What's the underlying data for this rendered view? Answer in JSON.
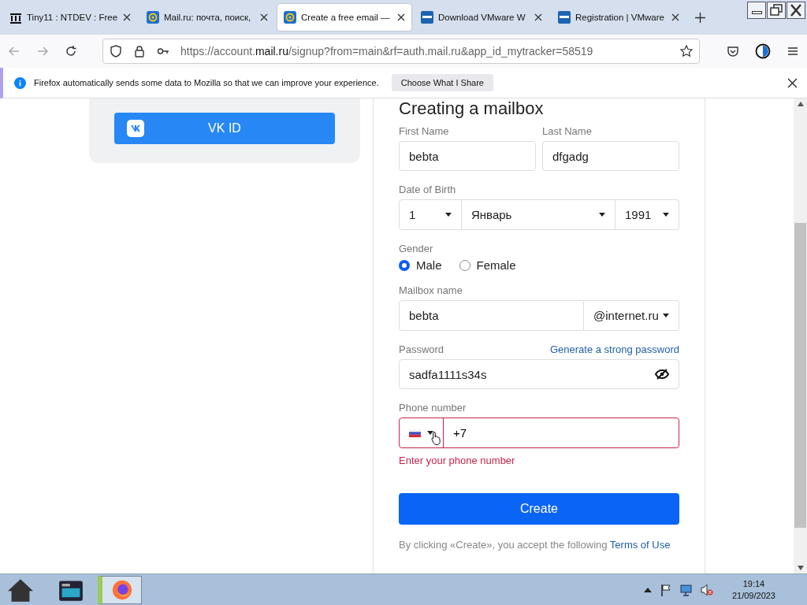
{
  "tabs": [
    {
      "title": "Tiny11 : NTDEV : Free",
      "kind": "building",
      "selected": false
    },
    {
      "title": "Mail.ru: почта, поиск,",
      "kind": "at",
      "selected": false
    },
    {
      "title": "Create a free email —",
      "kind": "at",
      "selected": true
    },
    {
      "title": "Download VMware W",
      "kind": "square",
      "selected": false
    },
    {
      "title": "Registration | VMware",
      "kind": "square",
      "selected": false
    }
  ],
  "address": {
    "scheme": "https://account.",
    "domain": "mail.ru",
    "rest": "/signup?from=main&rf=auth.mail.ru&app_id_mytracker=58519"
  },
  "notification": {
    "text": "Firefox automatically sends some data to Mozilla so that we can improve your experience.",
    "button": "Choose What I Share"
  },
  "vk_card": {
    "button": "VK ID"
  },
  "form": {
    "title": "Creating a mailbox",
    "first_name": {
      "label": "First Name",
      "value": "bebta"
    },
    "last_name": {
      "label": "Last Name",
      "value": "dfgadg"
    },
    "birth": {
      "label": "Date of Birth",
      "day": "1",
      "month": "Январь",
      "year": "1991"
    },
    "gender": {
      "label": "Gender",
      "options": [
        {
          "label": "Male",
          "selected": true
        },
        {
          "label": "Female",
          "selected": false
        }
      ]
    },
    "mailbox": {
      "label": "Mailbox name",
      "value": "bebta",
      "domain": "@internet.ru"
    },
    "password": {
      "label": "Password",
      "link": "Generate a strong password",
      "value": "sadfa1111s34s"
    },
    "phone": {
      "label": "Phone number",
      "value": "+7",
      "error": "Enter your phone number",
      "invalid": true
    },
    "create": "Create",
    "terms": {
      "text": "By clicking «Create», you accept the following",
      "link": "Terms of Use"
    }
  },
  "taskbar": {
    "time": "19:14",
    "date": "21/09/2023"
  }
}
